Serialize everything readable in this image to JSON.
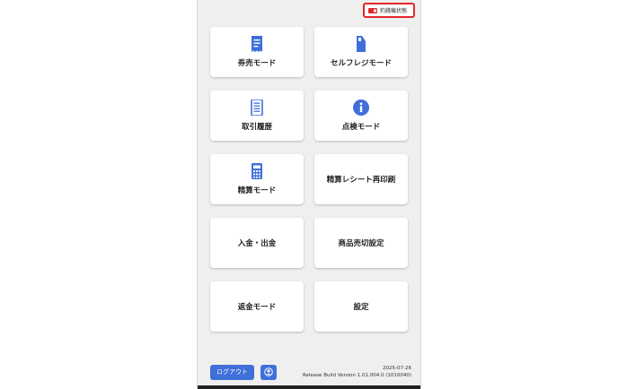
{
  "status_badge": {
    "label": "釣銭機状態",
    "icon": "cash-machine-icon",
    "color": "#e4262b"
  },
  "menu": {
    "ticket_mode": {
      "label": "券売モード",
      "icon": "receipt-icon"
    },
    "self_register_mode": {
      "label": "セルフレジモード",
      "icon": "pos-terminal-icon"
    },
    "transaction_history": {
      "label": "取引履歴",
      "icon": "notebook-icon"
    },
    "inspection_mode": {
      "label": "点検モード",
      "icon": "info-icon"
    },
    "settlement_mode": {
      "label": "精算モード",
      "icon": "calculator-icon"
    },
    "settlement_reprint": {
      "label": "精算レシート再印刷"
    },
    "cash_in_out": {
      "label": "入金・出金"
    },
    "sold_out_settings": {
      "label": "商品売切設定"
    },
    "refund_mode": {
      "label": "返金モード"
    },
    "settings": {
      "label": "設定"
    }
  },
  "footer": {
    "logout_label": "ログアウト",
    "user_icon": "user-circle-icon",
    "date": "2025-07-26",
    "build": "Release Build Version 1.01.004.0 (1010040)"
  },
  "colors": {
    "accent": "#3f6fd9",
    "alert": "#e4262b",
    "background": "#efefef"
  }
}
